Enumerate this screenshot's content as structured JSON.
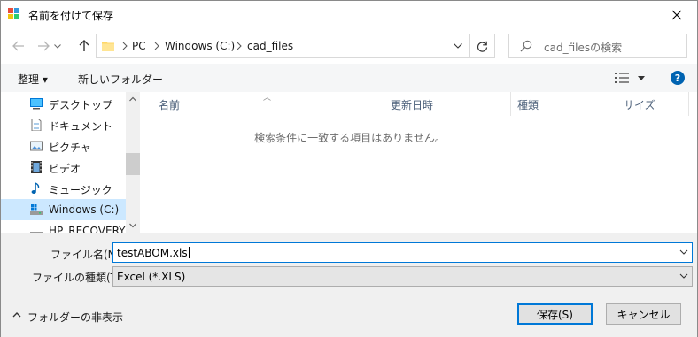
{
  "window": {
    "title": "名前を付けて保存"
  },
  "address": {
    "crumbs": [
      "PC",
      "Windows (C:)",
      "cad_files"
    ],
    "search_placeholder": "cad_filesの検索"
  },
  "toolbar": {
    "organize_label": "整理 ▾",
    "new_folder_label": "新しいフォルダー"
  },
  "nav": {
    "items": [
      {
        "label": "デスクトップ",
        "icon": "desktop-icon"
      },
      {
        "label": "ドキュメント",
        "icon": "document-icon"
      },
      {
        "label": "ピクチャ",
        "icon": "pictures-icon"
      },
      {
        "label": "ビデオ",
        "icon": "video-icon"
      },
      {
        "label": "ミュージック",
        "icon": "music-icon"
      },
      {
        "label": "Windows (C:)",
        "icon": "drive-icon",
        "selected": true
      },
      {
        "label": "HP_RECOVERY (",
        "icon": "drive-icon"
      }
    ]
  },
  "filelist": {
    "columns": [
      "名前",
      "更新日時",
      "種類",
      "サイズ"
    ],
    "empty_message": "検索条件に一致する項目はありません。"
  },
  "form": {
    "filename_label": "ファイル名(N):",
    "filename_value": "testABOM.xls",
    "filetype_label": "ファイルの種類(T):",
    "filetype_value": "Excel (*.XLS)"
  },
  "footer": {
    "hide_folders_label": "フォルダーの非表示",
    "save_label": "保存(S)",
    "cancel_label": "キャンセル"
  },
  "colors": {
    "accent": "#0078d7",
    "selection": "#cce8ff",
    "help": "#0063b1"
  }
}
